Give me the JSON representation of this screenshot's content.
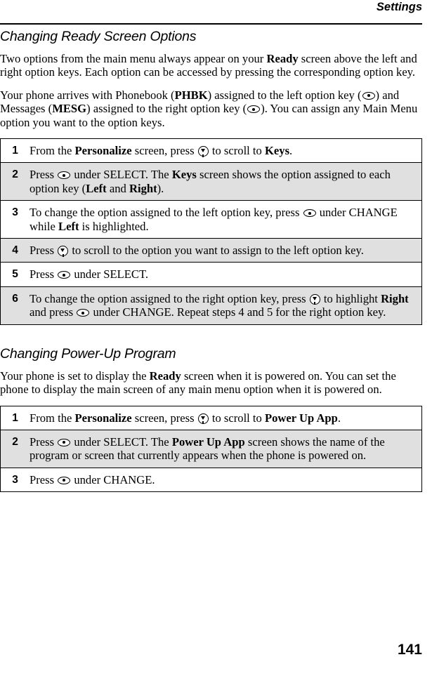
{
  "page": {
    "running_head": "Settings",
    "folio": "141"
  },
  "icons": {
    "option_key": "option-key-icon",
    "scroll_key": "scroll-key-icon"
  },
  "sections": [
    {
      "heading": "Changing Ready Screen Options",
      "paragraphs": [
        {
          "parts": [
            {
              "t": "Two options from the main menu always appear on your ",
              "s": "plain"
            },
            {
              "t": "Ready",
              "s": "bold"
            },
            {
              "t": " screen above the left and right option keys. Each option can be accessed by pressing the corresponding option key.",
              "s": "plain"
            }
          ]
        },
        {
          "parts": [
            {
              "t": "Your phone arrives with Phonebook (",
              "s": "plain"
            },
            {
              "t": "PHBK",
              "s": "bold"
            },
            {
              "t": ") assigned to the left option key (",
              "s": "plain"
            },
            {
              "t": "",
              "s": "key-icon"
            },
            {
              "t": ") and Messages (",
              "s": "plain"
            },
            {
              "t": "MESG",
              "s": "bold"
            },
            {
              "t": ") assigned to the right option key (",
              "s": "plain"
            },
            {
              "t": "",
              "s": "key-icon"
            },
            {
              "t": "). You can assign any Main Menu option you want to the option keys.",
              "s": "plain"
            }
          ]
        }
      ],
      "steps": [
        {
          "num": "1",
          "shade": "white",
          "parts": [
            {
              "t": "From the ",
              "s": "plain"
            },
            {
              "t": "Personalize",
              "s": "bold"
            },
            {
              "t": " screen, press ",
              "s": "plain"
            },
            {
              "t": "",
              "s": "scroll-icon"
            },
            {
              "t": " to scroll to ",
              "s": "plain"
            },
            {
              "t": "Keys",
              "s": "bold"
            },
            {
              "t": ".",
              "s": "plain"
            }
          ]
        },
        {
          "num": "2",
          "shade": "gray",
          "parts": [
            {
              "t": "Press ",
              "s": "plain"
            },
            {
              "t": "",
              "s": "key-icon"
            },
            {
              "t": " under SELECT. The ",
              "s": "plain"
            },
            {
              "t": "Keys",
              "s": "bold"
            },
            {
              "t": " screen shows the option assigned to each option key (",
              "s": "plain"
            },
            {
              "t": "Left",
              "s": "bold"
            },
            {
              "t": " and ",
              "s": "plain"
            },
            {
              "t": "Right",
              "s": "bold"
            },
            {
              "t": ").",
              "s": "plain"
            }
          ]
        },
        {
          "num": "3",
          "shade": "white",
          "parts": [
            {
              "t": "To change the option assigned to the left option key, press ",
              "s": "plain"
            },
            {
              "t": "",
              "s": "key-icon"
            },
            {
              "t": " under CHANGE while ",
              "s": "plain"
            },
            {
              "t": "Left",
              "s": "bold"
            },
            {
              "t": " is highlighted.",
              "s": "plain"
            }
          ]
        },
        {
          "num": "4",
          "shade": "gray",
          "parts": [
            {
              "t": "Press ",
              "s": "plain"
            },
            {
              "t": "",
              "s": "scroll-icon"
            },
            {
              "t": " to scroll to the option you want to assign to the left option key.",
              "s": "plain"
            }
          ]
        },
        {
          "num": "5",
          "shade": "white",
          "parts": [
            {
              "t": "Press ",
              "s": "plain"
            },
            {
              "t": "",
              "s": "key-icon"
            },
            {
              "t": " under SELECT.",
              "s": "plain"
            }
          ]
        },
        {
          "num": "6",
          "shade": "gray",
          "parts": [
            {
              "t": "To change the option assigned to the right option key, press ",
              "s": "plain"
            },
            {
              "t": "",
              "s": "scroll-icon"
            },
            {
              "t": " to highlight ",
              "s": "plain"
            },
            {
              "t": "Right",
              "s": "bold"
            },
            {
              "t": " and press ",
              "s": "plain"
            },
            {
              "t": "",
              "s": "key-icon"
            },
            {
              "t": " under CHANGE. Repeat steps 4 and 5 for the right option key.",
              "s": "plain"
            }
          ]
        }
      ]
    },
    {
      "heading": "Changing Power-Up Program",
      "paragraphs": [
        {
          "parts": [
            {
              "t": "Your phone is set to display the ",
              "s": "plain"
            },
            {
              "t": "Ready",
              "s": "bold"
            },
            {
              "t": " screen when it is powered on. You can set the phone to display the main screen of any main menu option when it is powered on.",
              "s": "plain"
            }
          ]
        }
      ],
      "steps": [
        {
          "num": "1",
          "shade": "white",
          "parts": [
            {
              "t": "From the ",
              "s": "plain"
            },
            {
              "t": "Personalize",
              "s": "bold"
            },
            {
              "t": " screen, press ",
              "s": "plain"
            },
            {
              "t": "",
              "s": "scroll-icon"
            },
            {
              "t": " to scroll to ",
              "s": "plain"
            },
            {
              "t": "Power Up App",
              "s": "bold"
            },
            {
              "t": ".",
              "s": "plain"
            }
          ]
        },
        {
          "num": "2",
          "shade": "gray",
          "parts": [
            {
              "t": "Press ",
              "s": "plain"
            },
            {
              "t": "",
              "s": "key-icon"
            },
            {
              "t": " under SELECT. The ",
              "s": "plain"
            },
            {
              "t": "Power Up App",
              "s": "bold"
            },
            {
              "t": " screen shows the name of the program or screen that currently appears when the phone is powered on.",
              "s": "plain"
            }
          ]
        },
        {
          "num": "3",
          "shade": "white",
          "parts": [
            {
              "t": "Press ",
              "s": "plain"
            },
            {
              "t": "",
              "s": "key-icon"
            },
            {
              "t": " under CHANGE.",
              "s": "plain"
            }
          ]
        }
      ]
    }
  ]
}
